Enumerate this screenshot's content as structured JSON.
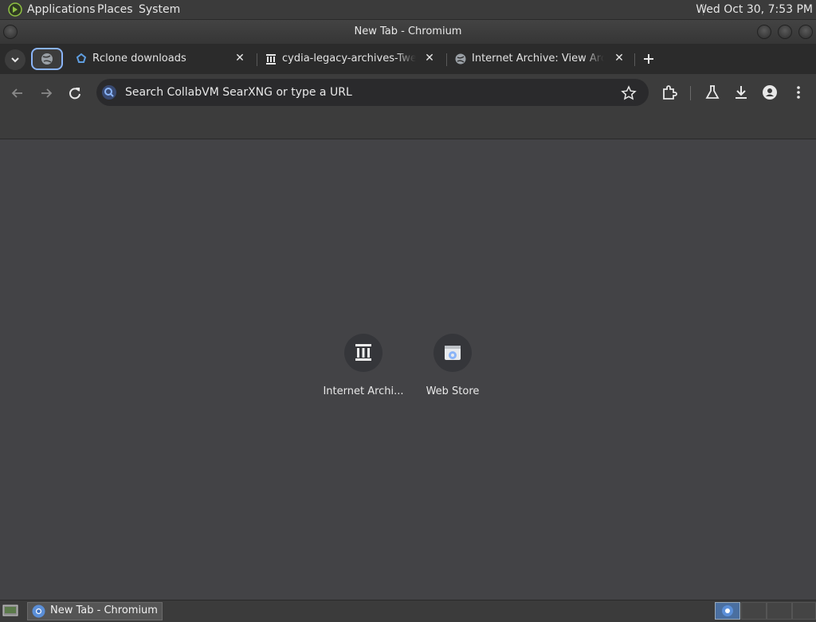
{
  "panel": {
    "menus": [
      "Applications",
      "Places",
      "System"
    ],
    "clock": "Wed Oct 30,  7:53 PM"
  },
  "window": {
    "title": "New Tab - Chromium"
  },
  "tabs": [
    {
      "title": "Rclone downloads",
      "icon": "rclone-icon"
    },
    {
      "title": "cydia-legacy-archives-Tweak",
      "icon": "archive-icon"
    },
    {
      "title": "Internet Archive: View Archiv",
      "icon": "globe-icon"
    }
  ],
  "omnibox": {
    "placeholder": "Search CollabVM SearXNG or type a URL"
  },
  "shortcuts": [
    {
      "label": "Internet Archi...",
      "icon": "archive-icon"
    },
    {
      "label": "Web Store",
      "icon": "web-store-icon"
    }
  ],
  "taskbar": {
    "item": "New Tab - Chromium"
  },
  "colors": {
    "accent": "#8ab4f8",
    "content_bg": "#434346"
  }
}
